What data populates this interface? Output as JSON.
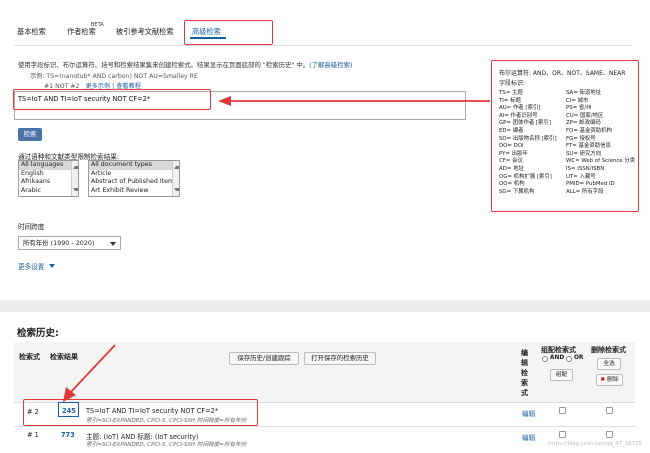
{
  "tabs": [
    {
      "label": "基本检索"
    },
    {
      "label": "作者检索"
    },
    {
      "label": "被引参考文献检索"
    },
    {
      "label": "高级检索"
    }
  ],
  "beta_badge": "BETA",
  "help": {
    "text": "使用字段标识、布尔运算符、括号和检索结果集来创建检索式。结果显示在页面底部的 \"检索历史\" 中。",
    "link": "(了解高级检索)",
    "example1": "示例: TS=(nanotub* AND carbon) NOT AU=Smalley RE",
    "example2_prefix": "#1 NOT #2",
    "example2_links": "更多示例 | 查看教程"
  },
  "query": {
    "value": "TS=IoT AND TI=IoT security NOT CF=2*"
  },
  "search_button": "检索",
  "limits": {
    "label": "通过语种和文献类型限制检索结果:",
    "languages": [
      "All languages",
      "English",
      "Afrikaans",
      "Arabic"
    ],
    "doc_types": [
      "All document types",
      "Article",
      "Abstract of Published Item",
      "Art Exhibit Review"
    ]
  },
  "timespan": {
    "label": "时间跨度",
    "selected": "所有年份 (1990 - 2020)"
  },
  "more_settings": "更多设置",
  "boolean_panel": {
    "title": "布尔运算符: AND、OR、NOT、SAME、NEAR",
    "subtitle": "字段标识:",
    "left": [
      "TS= 主题",
      "TI= 标题",
      "AU= 作者 [索引]",
      "AI= 作者识别号",
      "GP= 团体作者 [索引]",
      "ED= 编者",
      "SO= 出版物名称 [索引]",
      "DO= DOI",
      "PY= 出版年",
      "CF= 会议",
      "AD= 地址",
      "OG= 机构扩展 [索引]",
      "OO= 机构",
      "SG= 下属机构"
    ],
    "right": [
      "SA= 街道地址",
      "CI= 城市",
      "PS= 省/州",
      "CU= 国家/地区",
      "ZP= 邮政编码",
      "FO= 基金资助机构",
      "FG= 授权号",
      "FT= 基金资助信息",
      "SU= 研究方向",
      "WC= Web of Science 分类",
      "IS= ISSN/ISBN",
      "UT= 入藏号",
      "PMID= PubMed ID",
      "ALL= 所有字段"
    ]
  },
  "history": {
    "title": "检索历史:",
    "col_set": "检索式",
    "col_results": "检索结果",
    "save_btn": "保存历史/创建跟踪",
    "open_btn": "打开保存的检索历史",
    "col_edit": "编辑检索式",
    "col_combine": "组配检索式",
    "combine_and": "AND",
    "combine_or": "OR",
    "combine_btn": "组配",
    "col_delete": "删除检索式",
    "select_all_btn": "全选",
    "delete_btn": "删除",
    "rows": [
      {
        "set": "# 2",
        "results": "245",
        "query": "TS=IoT AND TI=IoT security NOT CF=2*",
        "meta": "索引=SCI-EXPANDED, CPCI-S, CPCI-SSH 时间跨度=所有年份",
        "edit": "编辑"
      },
      {
        "set": "# 1",
        "results": "773",
        "query": "主题: (IoT) AND 标题: (IoT security)",
        "meta": "索引=SCI-EXPANDED, CPCI-S, CPCI-SSH 时间跨度=所有年份",
        "edit": "编辑"
      }
    ]
  },
  "watermark": "https://blog.csdn.net/qq_47_16725",
  "colors": {
    "accent": "#1a5ea8",
    "annotation_red": "#e03a3a",
    "button_blue": "#4a74a8"
  }
}
